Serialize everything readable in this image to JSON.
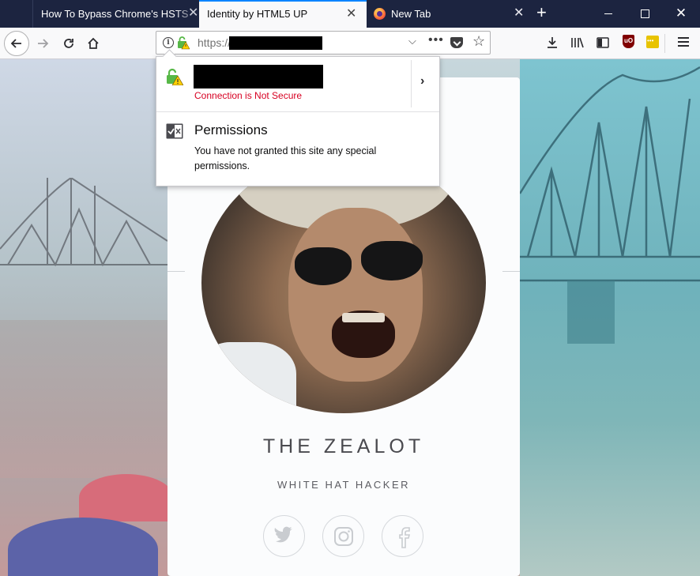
{
  "browser": {
    "tabs": [
      {
        "title": "How To Bypass Chrome's HSTS W",
        "active": false
      },
      {
        "title": "Identity by HTML5 UP",
        "active": true
      },
      {
        "title": "New Tab",
        "active": false
      }
    ],
    "new_tab_icon": "plus-icon",
    "window_controls": [
      "minimize-icon",
      "maximize-icon",
      "close-icon"
    ],
    "url_prefix": "https://",
    "accent_color": "#0a84ff"
  },
  "identity_popup": {
    "connection_status": "Connection is Not Secure",
    "permissions_title": "Permissions",
    "permissions_desc": "You have not granted this site any special permissions.",
    "status_color": "#d70022"
  },
  "profile": {
    "name": "THE ZEALOT",
    "subtitle": "WHITE HAT HACKER",
    "social": [
      "twitter-icon",
      "instagram-icon",
      "facebook-icon"
    ]
  }
}
